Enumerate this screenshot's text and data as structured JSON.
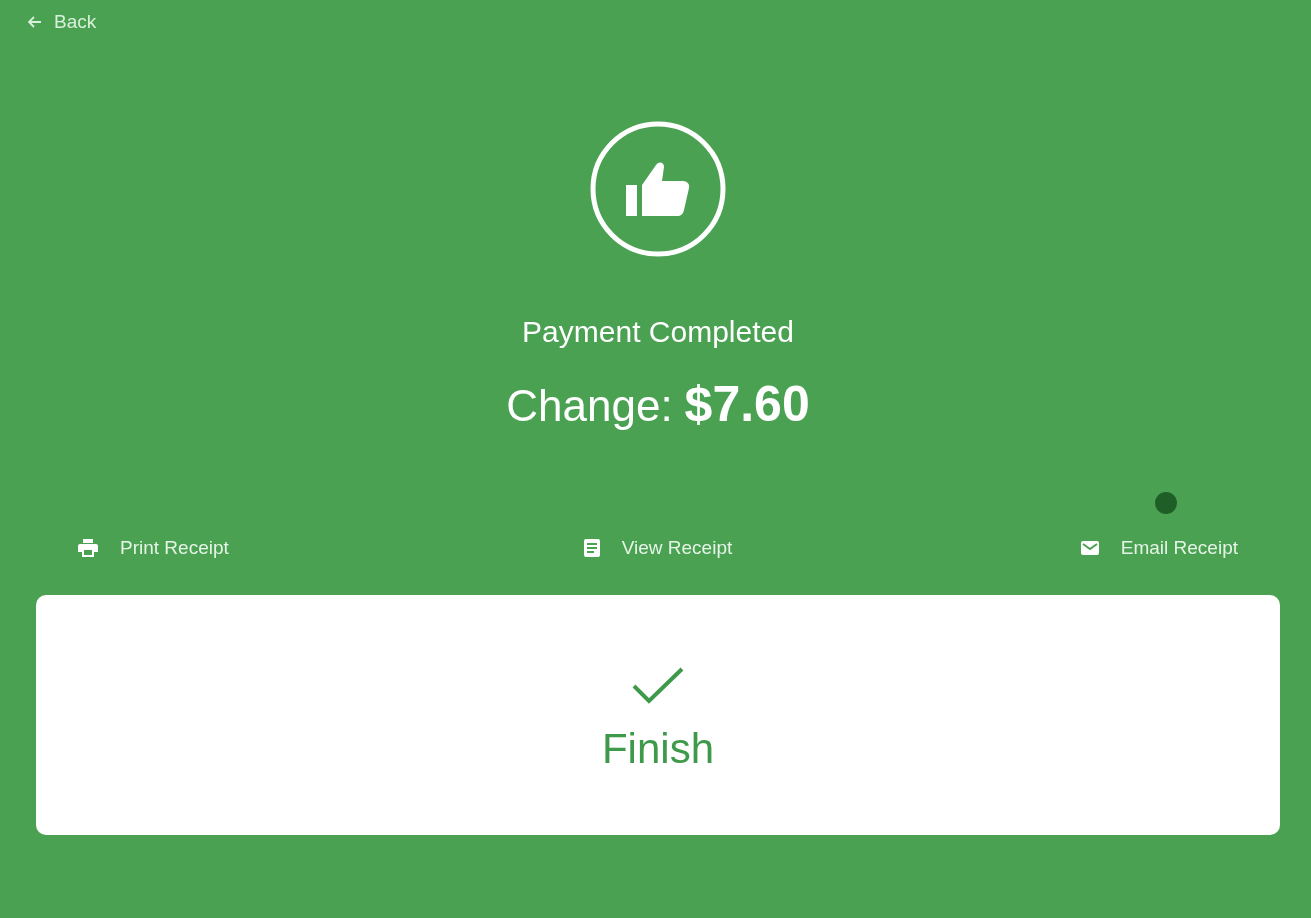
{
  "back": {
    "label": "Back"
  },
  "status": {
    "title": "Payment Completed",
    "change_label": "Change:",
    "change_amount": "$7.60"
  },
  "actions": [
    {
      "kind": "print",
      "label": "Print Receipt"
    },
    {
      "kind": "view",
      "label": "View Receipt"
    },
    {
      "kind": "email",
      "label": "Email Receipt"
    }
  ],
  "finish": {
    "label": "Finish"
  }
}
